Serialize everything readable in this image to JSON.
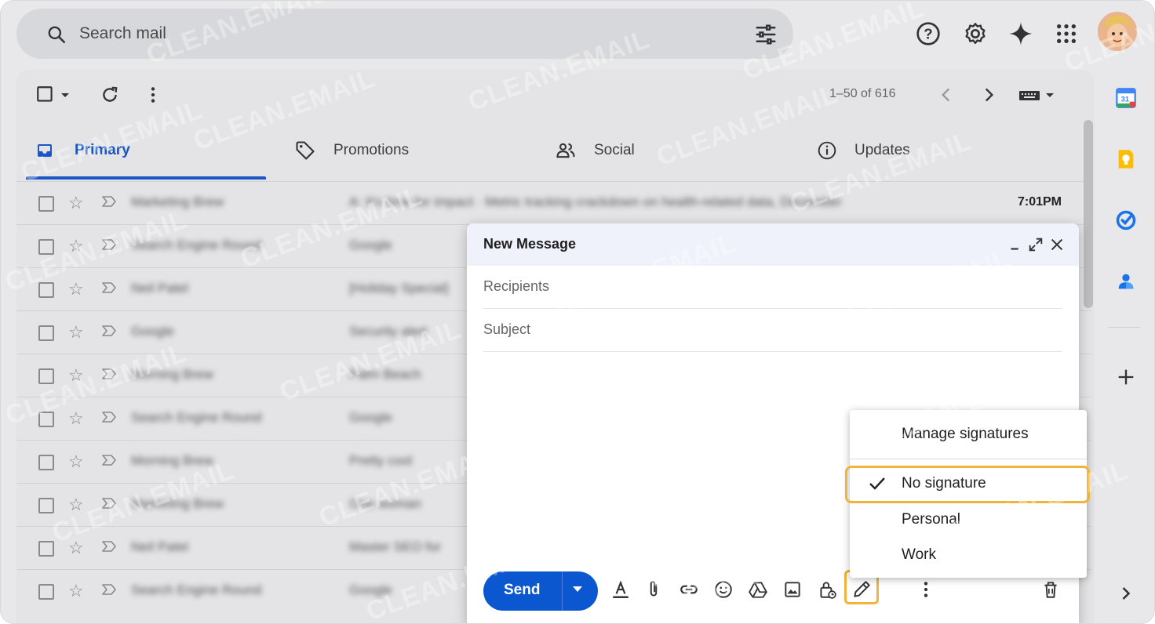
{
  "search": {
    "placeholder": "Search mail"
  },
  "pager": {
    "label": "1–50 of 616"
  },
  "tabs": [
    {
      "label": "Primary"
    },
    {
      "label": "Promotions"
    },
    {
      "label": "Social"
    },
    {
      "label": "Updates"
    }
  ],
  "emails": [
    {
      "sender": "Marketing Brew",
      "subject": "A: It's time for impact · Metric tracking crackdown on health-related data, December",
      "time": "7:01PM"
    },
    {
      "sender": "Search Engine Round",
      "subject": "Google",
      "time": ""
    },
    {
      "sender": "Neil Patel",
      "subject": "[Holiday Special]",
      "time": ""
    },
    {
      "sender": "Google",
      "subject": "Security alert",
      "time": ""
    },
    {
      "sender": "Morning Brew",
      "subject": "Palm Beach",
      "time": ""
    },
    {
      "sender": "Search Engine Round",
      "subject": "Google",
      "time": ""
    },
    {
      "sender": "Morning Brew",
      "subject": "Pretty cool",
      "time": ""
    },
    {
      "sender": "Marketing Brew",
      "subject": "One woman",
      "time": ""
    },
    {
      "sender": "Neil Patel",
      "subject": "Master SEO for",
      "time": ""
    },
    {
      "sender": "Search Engine Round",
      "subject": "Google",
      "time": ""
    }
  ],
  "compose": {
    "title": "New Message",
    "recipients_placeholder": "Recipients",
    "subject_placeholder": "Subject",
    "send_label": "Send"
  },
  "signature_menu": {
    "manage": "Manage signatures",
    "options": [
      {
        "label": "No signature",
        "checked": true
      },
      {
        "label": "Personal",
        "checked": false
      },
      {
        "label": "Work",
        "checked": false
      }
    ]
  },
  "watermark": "CLEAN.EMAIL",
  "colors": {
    "accent": "#0b57d0",
    "highlight": "#f0b43a"
  }
}
